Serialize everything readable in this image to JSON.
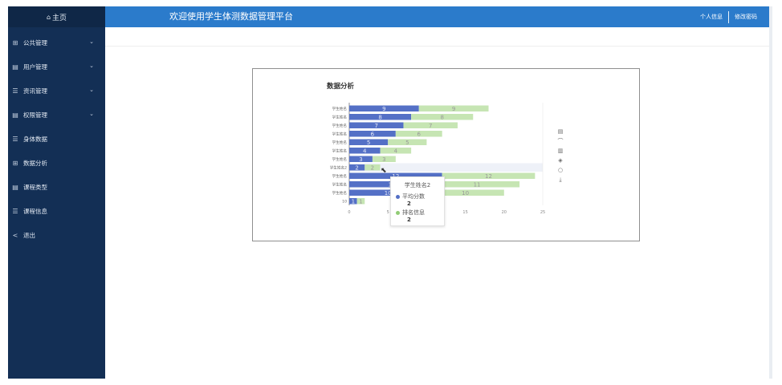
{
  "sidebar": {
    "home": "主页",
    "items": [
      {
        "label": "公共管理",
        "icon": "grid-icon",
        "glyph": "⊞",
        "has_children": true
      },
      {
        "label": "用户管理",
        "icon": "doc-icon",
        "glyph": "▤",
        "has_children": true
      },
      {
        "label": "资讯管理",
        "icon": "list-icon",
        "glyph": "☰",
        "has_children": true
      },
      {
        "label": "权限管理",
        "icon": "doc-icon",
        "glyph": "▤",
        "has_children": true
      },
      {
        "label": "身体数据",
        "icon": "list-icon",
        "glyph": "☰",
        "has_children": false
      },
      {
        "label": "数据分析",
        "icon": "grid-icon",
        "glyph": "⊞",
        "has_children": false
      },
      {
        "label": "课程类型",
        "icon": "doc-icon",
        "glyph": "▤",
        "has_children": false
      },
      {
        "label": "课程信息",
        "icon": "list-icon",
        "glyph": "☰",
        "has_children": false
      },
      {
        "label": "退出",
        "icon": "share-icon",
        "glyph": "<",
        "has_children": false
      }
    ]
  },
  "header": {
    "title": "欢迎使用学生体测数据管理平台",
    "profile_link": "个人信息",
    "password_link": "修改密码"
  },
  "panel": {
    "title": "数据分析"
  },
  "colors": {
    "sidebar_bg": "#132f55",
    "topbar_bg": "#2b7bcb",
    "series_avg": "#5470c6",
    "series_rank": "#c6e5b3"
  },
  "chart_data": {
    "type": "bar",
    "orientation": "horizontal",
    "categories": [
      "学生姓名",
      "学生姓名",
      "学生姓名",
      "学生姓名",
      "学生姓名",
      "学生姓名",
      "学生姓名",
      "学生姓名2",
      "学生姓名",
      "学生姓名",
      "学生姓名",
      "10"
    ],
    "series": [
      {
        "name": "平均分数",
        "values": [
          9,
          8,
          7,
          6,
          5,
          4,
          3,
          2,
          12,
          11,
          10,
          1
        ]
      },
      {
        "name": "排名信息",
        "values": [
          9,
          8,
          7,
          6,
          5,
          4,
          3,
          2,
          12,
          11,
          10,
          1
        ]
      }
    ],
    "xlim": [
      0,
      25
    ],
    "x_ticks": [
      "0",
      "5",
      "10",
      "15",
      "20",
      "25"
    ],
    "stacked": true,
    "legend": "none",
    "grid": false
  },
  "tooltip": {
    "title": "学生姓名2",
    "rows": [
      {
        "name": "平均分数",
        "value": "2"
      },
      {
        "name": "排名信息",
        "value": "2"
      }
    ]
  },
  "toolbox": [
    {
      "icon": "data-view-icon",
      "glyph": "▤"
    },
    {
      "icon": "line-chart-icon",
      "glyph": "⌒"
    },
    {
      "icon": "bar-chart-icon",
      "glyph": "▥"
    },
    {
      "icon": "stack-icon",
      "glyph": "◈"
    },
    {
      "icon": "restore-icon",
      "glyph": "○"
    },
    {
      "icon": "download-icon",
      "glyph": "⤓"
    }
  ]
}
